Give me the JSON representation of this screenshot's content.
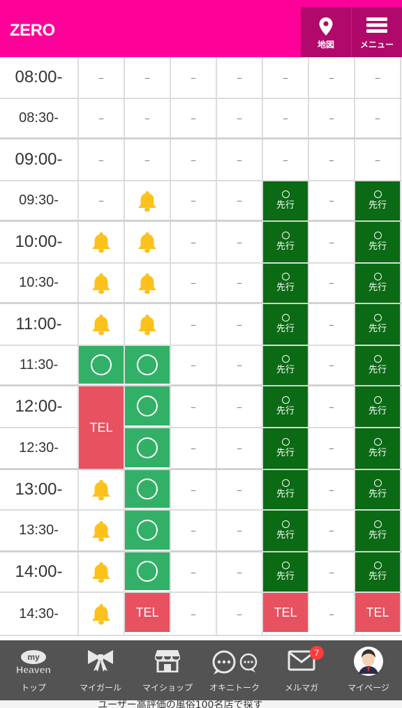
{
  "header": {
    "brand": "ZERO",
    "map_label": "地図",
    "menu_label": "メニュー",
    "map_icon": "map-pin-icon",
    "menu_icon": "hamburger-menu-icon",
    "colors": {
      "bar": "#ff0099",
      "buttons": "#b1086b"
    }
  },
  "schedule": {
    "status_labels": {
      "dash": "–",
      "tel": "TEL",
      "advance": "先行",
      "circle": "○",
      "bell": "bell-icon"
    },
    "colors": {
      "available": "#32b068",
      "tel": "#e85160",
      "advance": "#0b6a14",
      "bell": "#fcc21b"
    },
    "rows": [
      {
        "time": "08:00-",
        "cells": [
          "dash",
          "dash",
          "dash",
          "dash",
          "dash",
          "dash",
          "dash"
        ]
      },
      {
        "time": "08:30-",
        "cells": [
          "dash",
          "dash",
          "dash",
          "dash",
          "dash",
          "dash",
          "dash"
        ]
      },
      {
        "time": "09:00-",
        "cells": [
          "dash",
          "dash",
          "dash",
          "dash",
          "dash",
          "dash",
          "dash"
        ]
      },
      {
        "time": "09:30-",
        "cells": [
          "dash",
          "bell",
          "dash",
          "dash",
          "advance",
          "dash",
          "advance"
        ]
      },
      {
        "time": "10:00-",
        "cells": [
          "bell",
          "bell",
          "dash",
          "dash",
          "advance",
          "dash",
          "advance"
        ]
      },
      {
        "time": "10:30-",
        "cells": [
          "bell",
          "bell",
          "dash",
          "dash",
          "advance",
          "dash",
          "advance"
        ]
      },
      {
        "time": "11:00-",
        "cells": [
          "bell",
          "bell",
          "dash",
          "dash",
          "advance",
          "dash",
          "advance"
        ]
      },
      {
        "time": "11:30-",
        "cells": [
          "circle",
          "circle",
          "dash",
          "dash",
          "advance",
          "dash",
          "advance"
        ]
      },
      {
        "time": "12:00-",
        "cells": [
          "tel-span",
          "circle",
          "dash",
          "dash",
          "advance",
          "dash",
          "advance"
        ]
      },
      {
        "time": "12:30-",
        "cells": [
          "tel-cont",
          "circle",
          "dash",
          "dash",
          "advance",
          "dash",
          "advance"
        ]
      },
      {
        "time": "13:00-",
        "cells": [
          "bell",
          "circle",
          "dash",
          "dash",
          "advance",
          "dash",
          "advance"
        ]
      },
      {
        "time": "13:30-",
        "cells": [
          "bell",
          "circle",
          "dash",
          "dash",
          "advance",
          "dash",
          "advance"
        ]
      },
      {
        "time": "14:00-",
        "cells": [
          "bell",
          "circle",
          "dash",
          "dash",
          "advance",
          "dash",
          "advance"
        ]
      },
      {
        "time": "14:30-",
        "cells": [
          "bell",
          "tel",
          "dash",
          "dash",
          "tel",
          "dash",
          "tel"
        ]
      }
    ]
  },
  "tabbar": {
    "tabs": [
      {
        "label": "トップ",
        "icon": "my-heaven-logo-icon"
      },
      {
        "label": "マイガール",
        "icon": "ribbon-icon"
      },
      {
        "label": "マイショップ",
        "icon": "shop-icon"
      },
      {
        "label": "オキニトーク",
        "icon": "chat-bubbles-icon"
      },
      {
        "label": "メルマガ",
        "icon": "mail-icon"
      },
      {
        "label": "マイページ",
        "icon": "avatar-icon"
      }
    ],
    "mail_badge": "7",
    "logo_top": "my",
    "logo_bottom": "Heaven"
  },
  "footer": {
    "partial_text": "ユーザー高評価の風俗100名店で探す"
  }
}
